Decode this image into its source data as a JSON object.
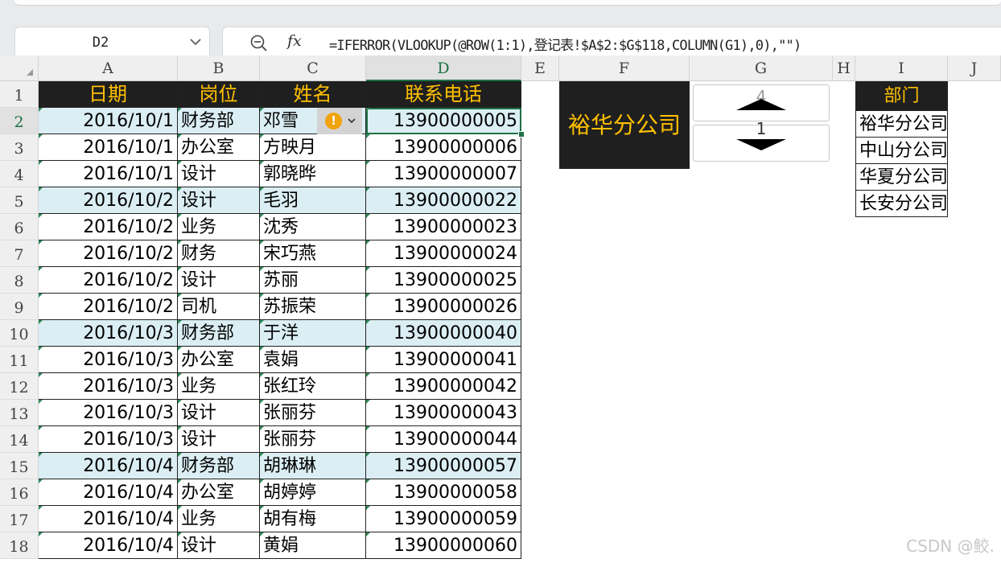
{
  "name_box": {
    "cell_ref": "D2"
  },
  "formula_bar": {
    "fx_label": "fx",
    "formula": "=IFERROR(VLOOKUP(@ROW(1:1),登记表!$A$2:$G$118,COLUMN(G1),0),\"\")"
  },
  "columns": [
    "A",
    "B",
    "C",
    "D",
    "E",
    "F",
    "G",
    "H",
    "I",
    "J"
  ],
  "rows": [
    "1",
    "2",
    "3",
    "4",
    "5",
    "6",
    "7",
    "8",
    "9",
    "10",
    "11",
    "12",
    "13",
    "14",
    "15",
    "16",
    "17",
    "18"
  ],
  "table": {
    "headers": [
      "日期",
      "岗位",
      "姓名",
      "联系电话"
    ],
    "rows": [
      [
        "2016/10/1",
        "财务部",
        "邓雪",
        "13900000005"
      ],
      [
        "2016/10/1",
        "办公室",
        "方映月",
        "13900000006"
      ],
      [
        "2016/10/1",
        "设计",
        "郭晓晔",
        "13900000007"
      ],
      [
        "2016/10/2",
        "设计",
        "毛羽",
        "13900000022"
      ],
      [
        "2016/10/2",
        "业务",
        "沈秀",
        "13900000023"
      ],
      [
        "2016/10/2",
        "财务",
        "宋巧燕",
        "13900000024"
      ],
      [
        "2016/10/2",
        "设计",
        "苏丽",
        "13900000025"
      ],
      [
        "2016/10/2",
        "司机",
        "苏振荣",
        "13900000026"
      ],
      [
        "2016/10/3",
        "财务部",
        "于洋",
        "13900000040"
      ],
      [
        "2016/10/3",
        "办公室",
        "袁娟",
        "13900000041"
      ],
      [
        "2016/10/3",
        "业务",
        "张红玲",
        "13900000042"
      ],
      [
        "2016/10/3",
        "设计",
        "张丽芬",
        "13900000043"
      ],
      [
        "2016/10/3",
        "设计",
        "张丽芬",
        "13900000044"
      ],
      [
        "2016/10/4",
        "财务部",
        "胡琳琳",
        "13900000057"
      ],
      [
        "2016/10/4",
        "办公室",
        "胡婷婷",
        "13900000058"
      ],
      [
        "2016/10/4",
        "业务",
        "胡有梅",
        "13900000059"
      ],
      [
        "2016/10/4",
        "设计",
        "黄娟",
        "13900000060"
      ]
    ],
    "highlighted_rows": [
      0,
      3,
      8,
      13
    ]
  },
  "company_box": {
    "label": "裕华分公司"
  },
  "spinner": {
    "top_value": "4",
    "bottom_value": "1"
  },
  "dept_list": {
    "header": "部门",
    "items": [
      "裕华分公司",
      "中山分公司",
      "华夏分公司",
      "长安分公司"
    ]
  },
  "watermark": "CSDN @鲛.",
  "colors": {
    "header_bg": "#1f1f1f",
    "header_text": "#ffc000",
    "highlight": "#dbeef4",
    "selection": "#1e7145"
  }
}
